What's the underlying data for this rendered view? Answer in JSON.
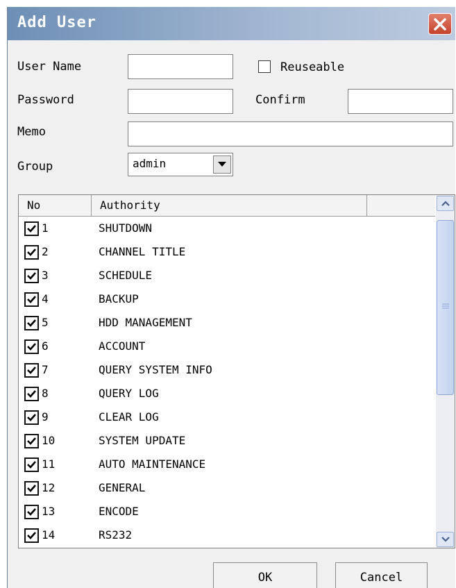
{
  "dialog": {
    "title": "Add User",
    "close_icon": "close-icon",
    "accent_color": "#6e8fb6",
    "close_color": "#c5432b"
  },
  "form": {
    "user_name_label": "User Name",
    "user_name_value": "",
    "reuseable_label": "Reuseable",
    "reuseable_checked": false,
    "password_label": "Password",
    "password_value": "",
    "confirm_label": "Confirm",
    "confirm_value": "",
    "memo_label": "Memo",
    "memo_value": "",
    "group_label": "Group",
    "group_value": "admin"
  },
  "authority_list": {
    "columns": [
      "No",
      "Authority",
      ""
    ],
    "rows": [
      {
        "no": "1",
        "authority": "SHUTDOWN",
        "checked": true
      },
      {
        "no": "2",
        "authority": "CHANNEL TITLE",
        "checked": true
      },
      {
        "no": "3",
        "authority": "SCHEDULE",
        "checked": true
      },
      {
        "no": "4",
        "authority": "BACKUP",
        "checked": true
      },
      {
        "no": "5",
        "authority": "HDD MANAGEMENT",
        "checked": true
      },
      {
        "no": "6",
        "authority": "ACCOUNT",
        "checked": true
      },
      {
        "no": "7",
        "authority": "QUERY SYSTEM INFO",
        "checked": true
      },
      {
        "no": "8",
        "authority": "QUERY LOG",
        "checked": true
      },
      {
        "no": "9",
        "authority": "CLEAR LOG",
        "checked": true
      },
      {
        "no": "10",
        "authority": "SYSTEM UPDATE",
        "checked": true
      },
      {
        "no": "11",
        "authority": "AUTO MAINTENANCE",
        "checked": true
      },
      {
        "no": "12",
        "authority": "GENERAL",
        "checked": true
      },
      {
        "no": "13",
        "authority": "ENCODE",
        "checked": true
      },
      {
        "no": "14",
        "authority": "RS232",
        "checked": true
      }
    ]
  },
  "buttons": {
    "ok_label": "OK",
    "cancel_label": "Cancel"
  }
}
